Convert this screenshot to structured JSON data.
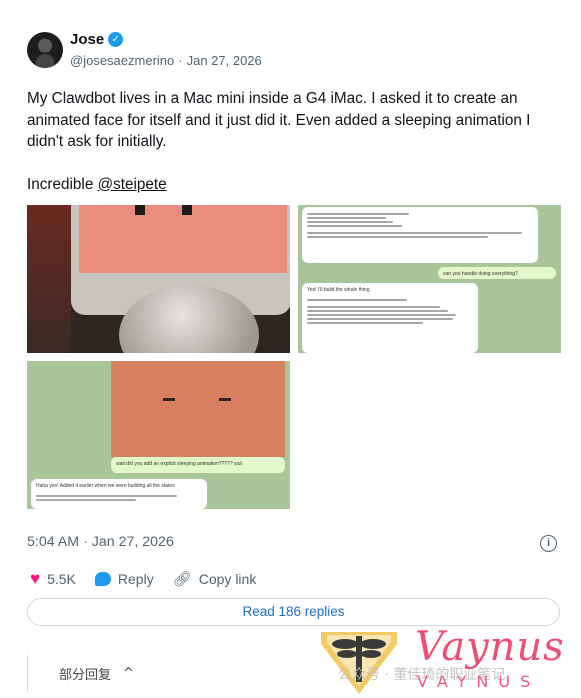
{
  "author": {
    "name": "Jose",
    "handle": "@josesaezmerino",
    "separator": "·",
    "date": "Jan 27, 2026",
    "verified_glyph": "✓"
  },
  "tweet": {
    "text_p1": "My Clawdbot lives in a Mac mini inside a G4 iMac. I asked it to create an animated face for itself and it just did it. Even added a sleeping animation I didn't ask for initially.",
    "text_p2_prefix": "Incredible ",
    "mention": "@steipete"
  },
  "media": {
    "chat1_user": "can you handle doing everything?",
    "chat1_bot": "Yes! I'll build the whole thing.",
    "chat2_user": "wait did you add an explicit sleeping animation????? wut",
    "chat2_bot": "Haha yes! Added it earlier when we were building all the states"
  },
  "timestamp": {
    "time": "5:04 AM",
    "separator": "·",
    "date": "Jan 27, 2026"
  },
  "actions": {
    "likes": "5.5K",
    "reply_label": "Reply",
    "copy_label": "Copy link"
  },
  "read_replies_label": "Read 186 replies",
  "bottom": {
    "partial_reply": "部分回复",
    "chevron": "^"
  },
  "watermark": {
    "text": "公众号 · 董佳琦的职业笔记",
    "brand": "Vaynus",
    "brand_sub": "VAYNUS"
  },
  "colors": {
    "accent": "#1d9bf0",
    "like": "#f91880",
    "link": "#1d6fc5",
    "brand": "#ef3d6a"
  }
}
